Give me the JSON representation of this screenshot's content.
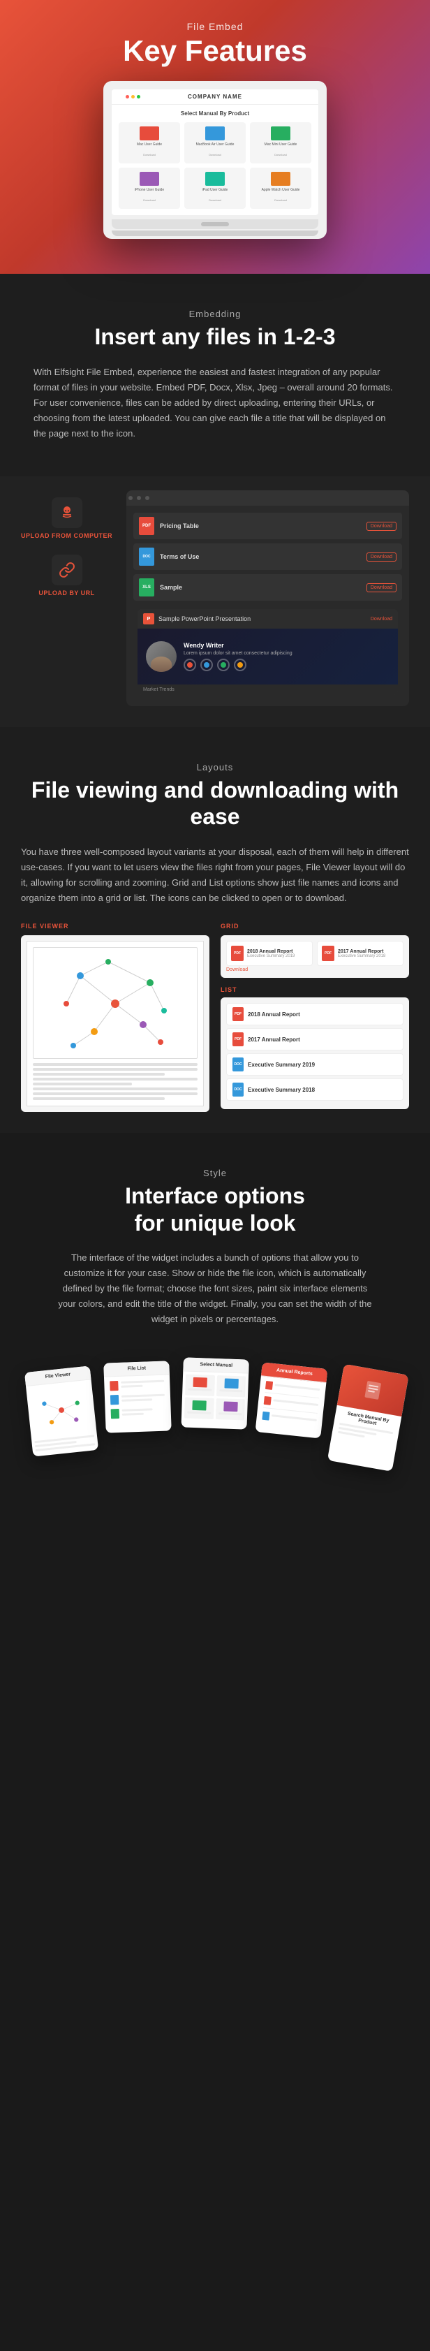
{
  "hero": {
    "subtitle": "File Embed",
    "title": "Key Features"
  },
  "laptop": {
    "company": "COMPANY NAME",
    "screen_title": "Select Manual By Product",
    "items": [
      {
        "name": "Mac User Guide",
        "sub": "Download",
        "color": "#e74c3c"
      },
      {
        "name": "MacBook Air User Guide",
        "sub": "Download",
        "color": "#3498db"
      },
      {
        "name": "Mac Mini User Guide",
        "sub": "Download",
        "color": "#27ae60"
      },
      {
        "name": "iPhone User Guide",
        "sub": "Download",
        "color": "#9b59b6"
      },
      {
        "name": "iPad User Guide",
        "sub": "Download",
        "color": "#1abc9c"
      },
      {
        "name": "Apple Watch User Guide",
        "sub": "Download",
        "color": "#e67e22"
      }
    ]
  },
  "embedding": {
    "label": "Embedding",
    "title": "Insert any files in 1-2-3",
    "text": "With Elfsight File Embed, experience the easiest and fastest integration of any popular format of files in your website. Embed PDF, Docx, Xlsx, Jpeg – overall around 20 formats. For user convenience, files can be added by direct uploading, entering their URLs, or choosing from the latest uploaded. You can give each file a title that will be displayed on the page next to the icon."
  },
  "upload": {
    "computer_label": "UPLOAD FROM COMPUTER",
    "url_label": "UPLOAD BY URL"
  },
  "files": [
    {
      "name": "Pricing Table",
      "type": "PDF",
      "color": "#e74c3c",
      "btn": "Download"
    },
    {
      "name": "Terms of Use",
      "type": "DOCX",
      "color": "#3498db",
      "btn": "Download"
    },
    {
      "name": "Sample",
      "type": "XLS",
      "color": "#27ae60",
      "btn": "Download"
    }
  ],
  "ppt": {
    "title": "Sample PowerPoint Presentation",
    "dl": "Download",
    "slide_title": "Wendy Writer",
    "slide_sub": "Lorem ipsum dolor sit amet consectetur adipiscing",
    "footer": "Market Trends"
  },
  "layouts": {
    "label": "Layouts",
    "title": "File viewing and downloading with ease",
    "text": "You have three well-composed layout variants at your disposal, each of them will help in different use-cases. If you want to let users view the files right from your pages, File Viewer layout will do it, allowing for scrolling and zooming. Grid and List options show just file names and icons and organize them into a grid or list. The icons can be clicked to open or to download.",
    "viewer_label": "FILE VIEWER",
    "grid_label": "GRID",
    "list_label": "LIST"
  },
  "grid_files": [
    {
      "name": "2018 Annual Report",
      "date": "Executive Summary 2019",
      "type": "PDF",
      "color": "#e74c3c"
    },
    {
      "name": "2017 Annual Report",
      "date": "Executive Summary 2018",
      "type": "PDF",
      "color": "#e74c3c"
    }
  ],
  "list_files": [
    {
      "name": "2018 Annual Report",
      "type": "PDF",
      "color": "#e74c3c"
    },
    {
      "name": "2017 Annual Report",
      "type": "PDF",
      "color": "#e74c3c"
    },
    {
      "name": "Executive Summary 2019",
      "type": "DOCX",
      "color": "#3498db"
    },
    {
      "name": "Executive Summary 2018",
      "type": "DOCX",
      "color": "#3498db"
    }
  ],
  "style": {
    "label": "Style",
    "title": "Interface options\nfor unique look",
    "text": "The interface of the widget includes a bunch of options that allow you to customize it for your case. Show or hide the file icon, which is automatically defined by the file format; choose the font sizes, paint six interface elements your colors, and edit the title of the widget. Finally, you can set the width of the widget in pixels or percentages."
  },
  "showcase_cards": [
    {
      "title": "File Viewer",
      "type": "graph"
    },
    {
      "title": "File List",
      "type": "lines"
    },
    {
      "title": "Select Manual By Product",
      "type": "grid"
    },
    {
      "title": "Annual Reports",
      "type": "list"
    },
    {
      "title": "Search Manual By Product",
      "type": "cover"
    }
  ]
}
